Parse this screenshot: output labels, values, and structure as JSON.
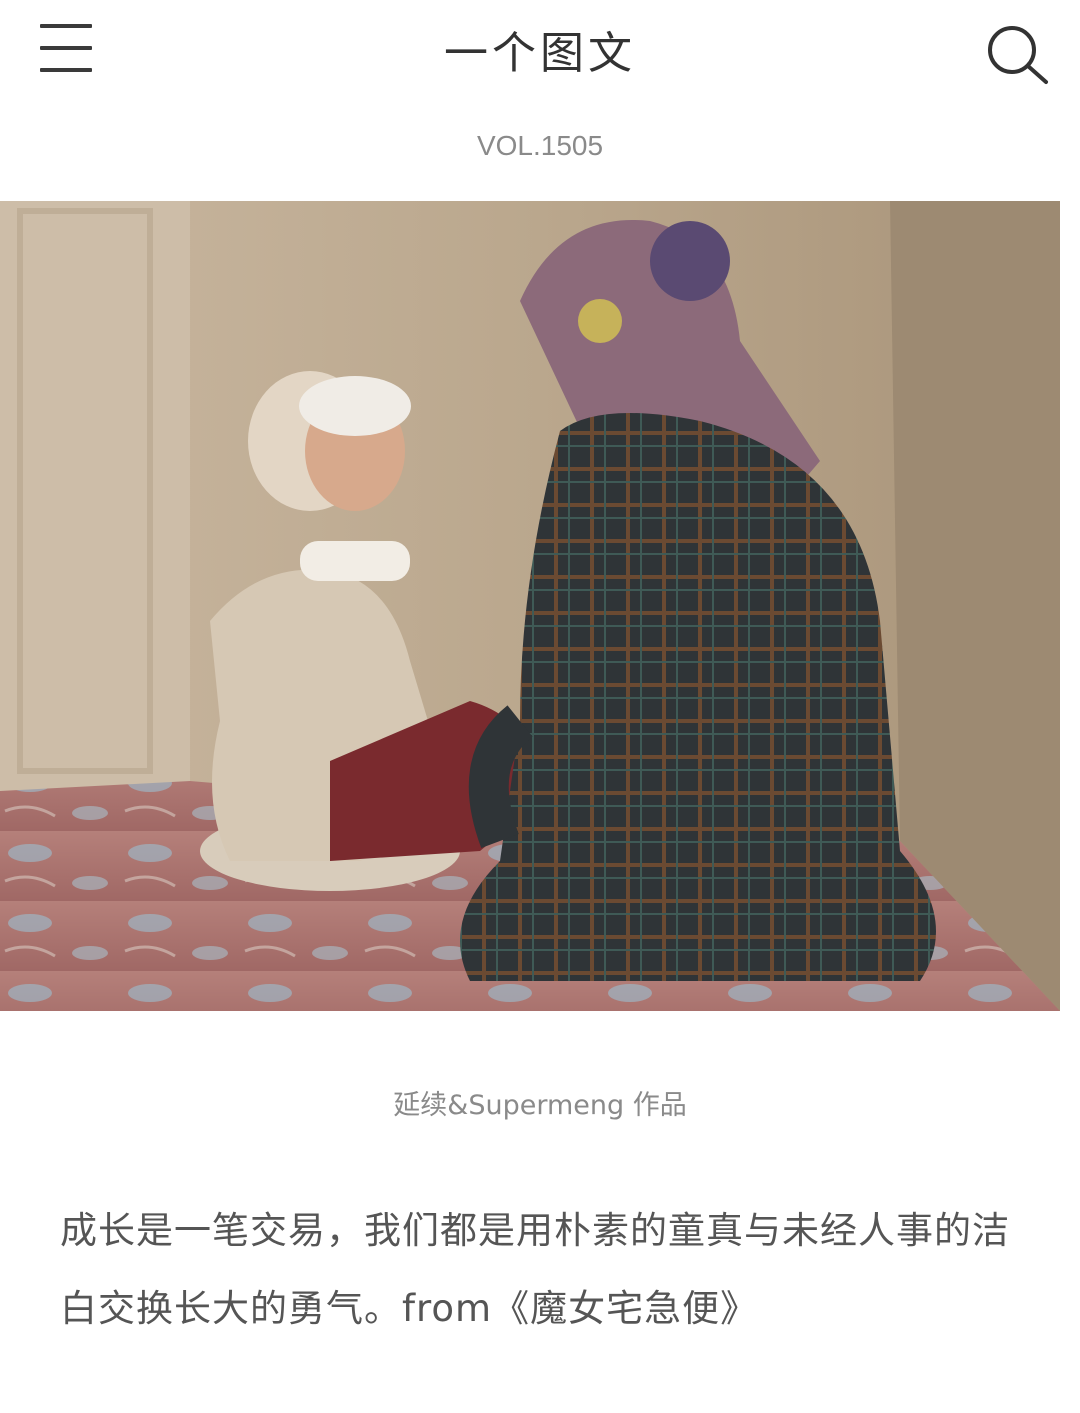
{
  "header": {
    "menu_icon": "menu-icon",
    "title": "一个图文",
    "search_icon": "search-icon"
  },
  "issue": {
    "vol": "VOL.1505"
  },
  "photo": {
    "subject": "photo"
  },
  "caption": {
    "author": "延续&Supermeng 作品"
  },
  "quote": {
    "text": "成长是一笔交易，我们都是用朴素的童真与未经人事的洁白交换长大的勇气。from《魔女宅急便》"
  },
  "colors": {
    "text_dark": "#333333",
    "text_gray": "#8a8a8a",
    "text_quote": "#555555",
    "background": "#ffffff"
  }
}
